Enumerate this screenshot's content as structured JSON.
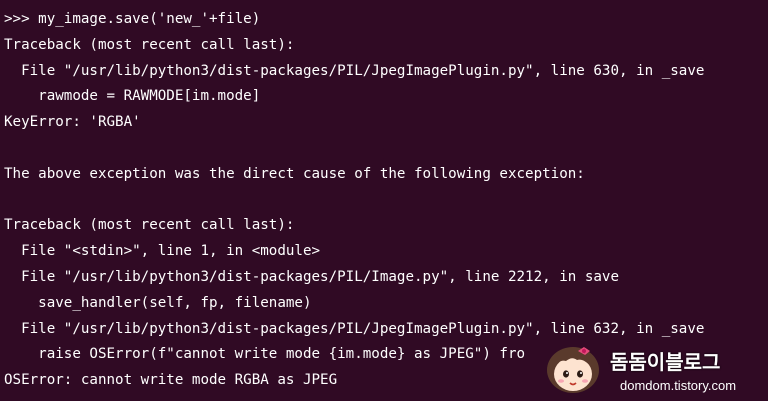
{
  "terminal": {
    "lines": [
      ">>> my_image.save('new_'+file)",
      "Traceback (most recent call last):",
      "  File \"/usr/lib/python3/dist-packages/PIL/JpegImagePlugin.py\", line 630, in _save",
      "    rawmode = RAWMODE[im.mode]",
      "KeyError: 'RGBA'",
      "",
      "The above exception was the direct cause of the following exception:",
      "",
      "Traceback (most recent call last):",
      "  File \"<stdin>\", line 1, in <module>",
      "  File \"/usr/lib/python3/dist-packages/PIL/Image.py\", line 2212, in save",
      "    save_handler(self, fp, filename)",
      "  File \"/usr/lib/python3/dist-packages/PIL/JpegImagePlugin.py\", line 632, in _save",
      "    raise OSError(f\"cannot write mode {im.mode} as JPEG\") fro",
      "OSError: cannot write mode RGBA as JPEG"
    ],
    "background_color": "#300a24",
    "text_color": "#ffffff"
  },
  "watermark": {
    "title": "돔돔이블로그",
    "url": "domdom.tistory.com",
    "avatar_icon": "cartoon-girl-avatar-icon"
  }
}
